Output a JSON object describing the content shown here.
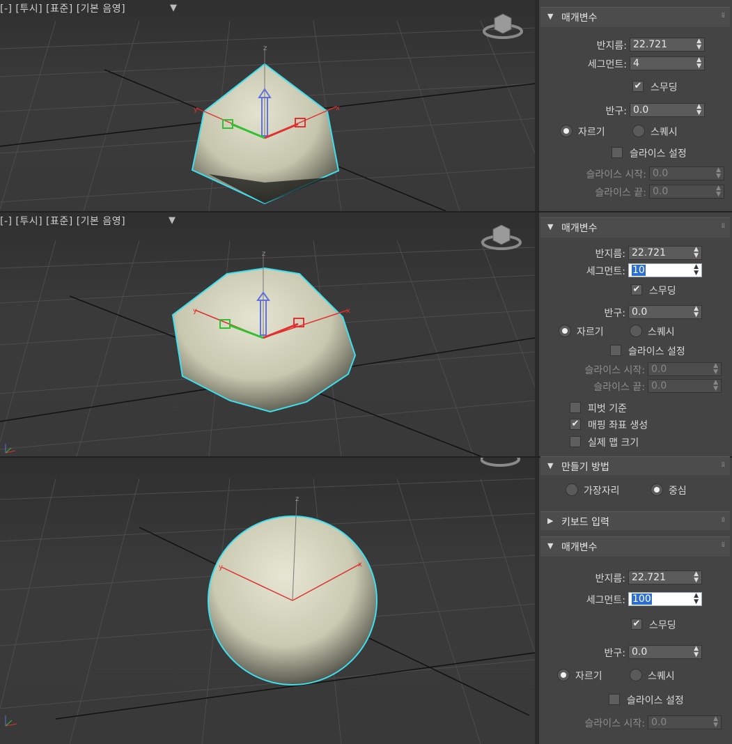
{
  "viewports": [
    {
      "label": "[-] [투시] [표준] [기본 음영]"
    },
    {
      "label": "[-] [투시] [표준] [기본 음영]"
    }
  ],
  "gizmo_axes": {
    "x": "x",
    "y": "y",
    "z": "z"
  },
  "panels": [
    {
      "rollout_title": "매개변수",
      "radius_label": "반지름:",
      "radius_value": "22.721",
      "segments_label": "세그먼트:",
      "segments_value": "4",
      "smooth_label": "스무딩",
      "hemisphere_label": "반구:",
      "hemisphere_value": "0.0",
      "chop_label": "자르기",
      "squash_label": "스퀘시",
      "slice_on_label": "슬라이스 설정",
      "slice_from_label": "슬라이스 시작:",
      "slice_from_value": "0.0",
      "slice_to_label": "슬라이스 끝:",
      "slice_to_value": "0.0"
    },
    {
      "rollout_title": "매개변수",
      "radius_label": "반지름:",
      "radius_value": "22.721",
      "segments_label": "세그먼트:",
      "segments_value": "10",
      "smooth_label": "스무딩",
      "hemisphere_label": "반구:",
      "hemisphere_value": "0.0",
      "chop_label": "자르기",
      "squash_label": "스퀘시",
      "slice_on_label": "슬라이스 설정",
      "slice_from_label": "슬라이스 시작:",
      "slice_from_value": "0.0",
      "slice_to_label": "슬라이스 끝:",
      "slice_to_value": "0.0",
      "base_to_pivot_label": "피벗 기준",
      "gen_mapping_label": "매핑 좌표 생성",
      "real_world_label": "실제 맵 크기"
    },
    {
      "creation_method_title": "만들기 방법",
      "edge_label": "가장자리",
      "center_label": "중심",
      "keyboard_entry_title": "키보드 입력",
      "rollout_title": "매개변수",
      "radius_label": "반지름:",
      "radius_value": "22.721",
      "segments_label": "세그먼트:",
      "segments_value": "100",
      "smooth_label": "스무딩",
      "hemisphere_label": "반구:",
      "hemisphere_value": "0.0",
      "chop_label": "자르기",
      "squash_label": "스퀘시",
      "slice_on_label": "슬라이스 설정",
      "slice_from_label": "슬라이스 시작:",
      "slice_from_value": "0.0"
    }
  ],
  "colors": {
    "selection_outline": "#3ee0f0",
    "sphere_fill": "#d6d6c0",
    "gizmo_x": "#e03030",
    "gizmo_y": "#30c030",
    "gizmo_z": "#6070e0"
  }
}
